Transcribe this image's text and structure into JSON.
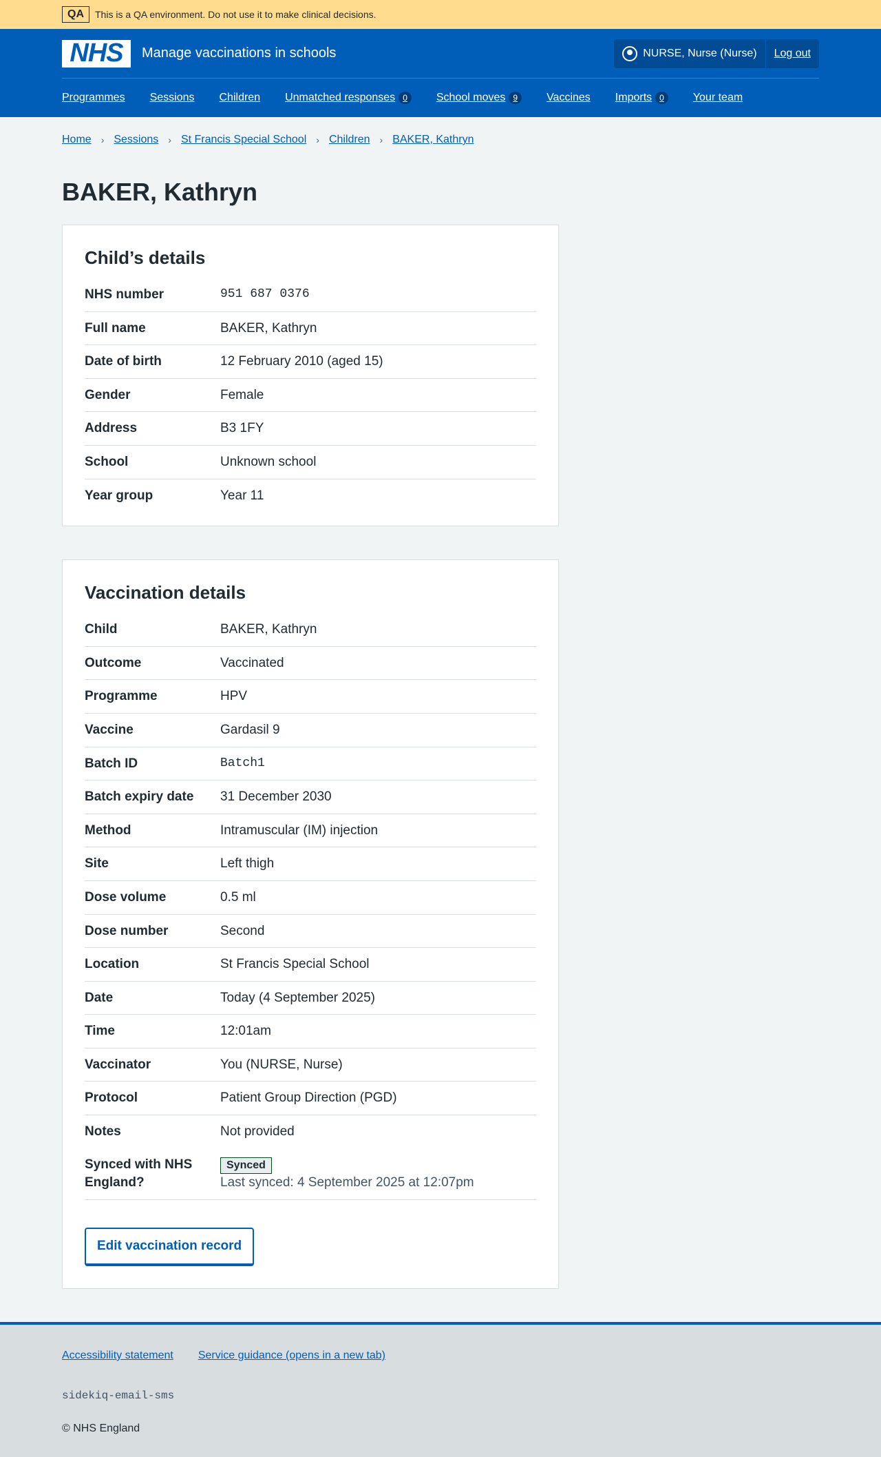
{
  "qa": {
    "tag": "QA",
    "message": "This is a QA environment. Do not use it to make clinical decisions."
  },
  "header": {
    "logo": "NHS",
    "service": "Manage vaccinations in schools",
    "user": "NURSE, Nurse (Nurse)",
    "logout": "Log out"
  },
  "nav": [
    {
      "label": "Programmes"
    },
    {
      "label": "Sessions"
    },
    {
      "label": "Children"
    },
    {
      "label": "Unmatched responses",
      "count": "0"
    },
    {
      "label": "School moves",
      "count": "9"
    },
    {
      "label": "Vaccines"
    },
    {
      "label": "Imports",
      "count": "0"
    },
    {
      "label": "Your team"
    }
  ],
  "breadcrumb": [
    "Home",
    "Sessions",
    "St Francis Special School",
    "Children",
    "BAKER, Kathryn"
  ],
  "title": "BAKER, Kathryn",
  "child": {
    "heading": "Child’s details",
    "rows": [
      {
        "k": "NHS number",
        "v": "951 687 0376"
      },
      {
        "k": "Full name",
        "v": "BAKER, Kathryn"
      },
      {
        "k": "Date of birth",
        "v": "12 February 2010 (aged 15)"
      },
      {
        "k": "Gender",
        "v": "Female"
      },
      {
        "k": "Address",
        "v": "B3 1FY"
      },
      {
        "k": "School",
        "v": "Unknown school"
      },
      {
        "k": "Year group",
        "v": "Year 11"
      }
    ]
  },
  "vacc": {
    "heading": "Vaccination details",
    "rows": [
      {
        "k": "Child",
        "v": "BAKER, Kathryn"
      },
      {
        "k": "Outcome",
        "v": "Vaccinated"
      },
      {
        "k": "Programme",
        "v": "HPV"
      },
      {
        "k": "Vaccine",
        "v": "Gardasil 9"
      },
      {
        "k": "Batch ID",
        "v": "Batch1"
      },
      {
        "k": "Batch expiry date",
        "v": "31 December 2030"
      },
      {
        "k": "Method",
        "v": "Intramuscular (IM) injection"
      },
      {
        "k": "Site",
        "v": "Left thigh"
      },
      {
        "k": "Dose volume",
        "v": "0.5 ml"
      },
      {
        "k": "Dose number",
        "v": "Second"
      },
      {
        "k": "Location",
        "v": "St Francis Special School"
      },
      {
        "k": "Date",
        "v": "Today (4 September 2025)"
      },
      {
        "k": "Time",
        "v": "12:01am"
      },
      {
        "k": "Vaccinator",
        "v": "You (NURSE, Nurse)"
      },
      {
        "k": "Protocol",
        "v": "Patient Group Direction (PGD)"
      },
      {
        "k": "Notes",
        "v": "Not provided"
      }
    ],
    "synced_label": "Synced with NHS England?",
    "synced_tag": "Synced",
    "last_synced": "Last synced: 4 September 2025 at 12:07pm",
    "edit": "Edit vaccination record"
  },
  "footer": {
    "links": [
      "Accessibility statement",
      "Service guidance (opens in a new tab)"
    ],
    "env": "sidekiq-email-sms",
    "copyright": "© NHS England"
  }
}
